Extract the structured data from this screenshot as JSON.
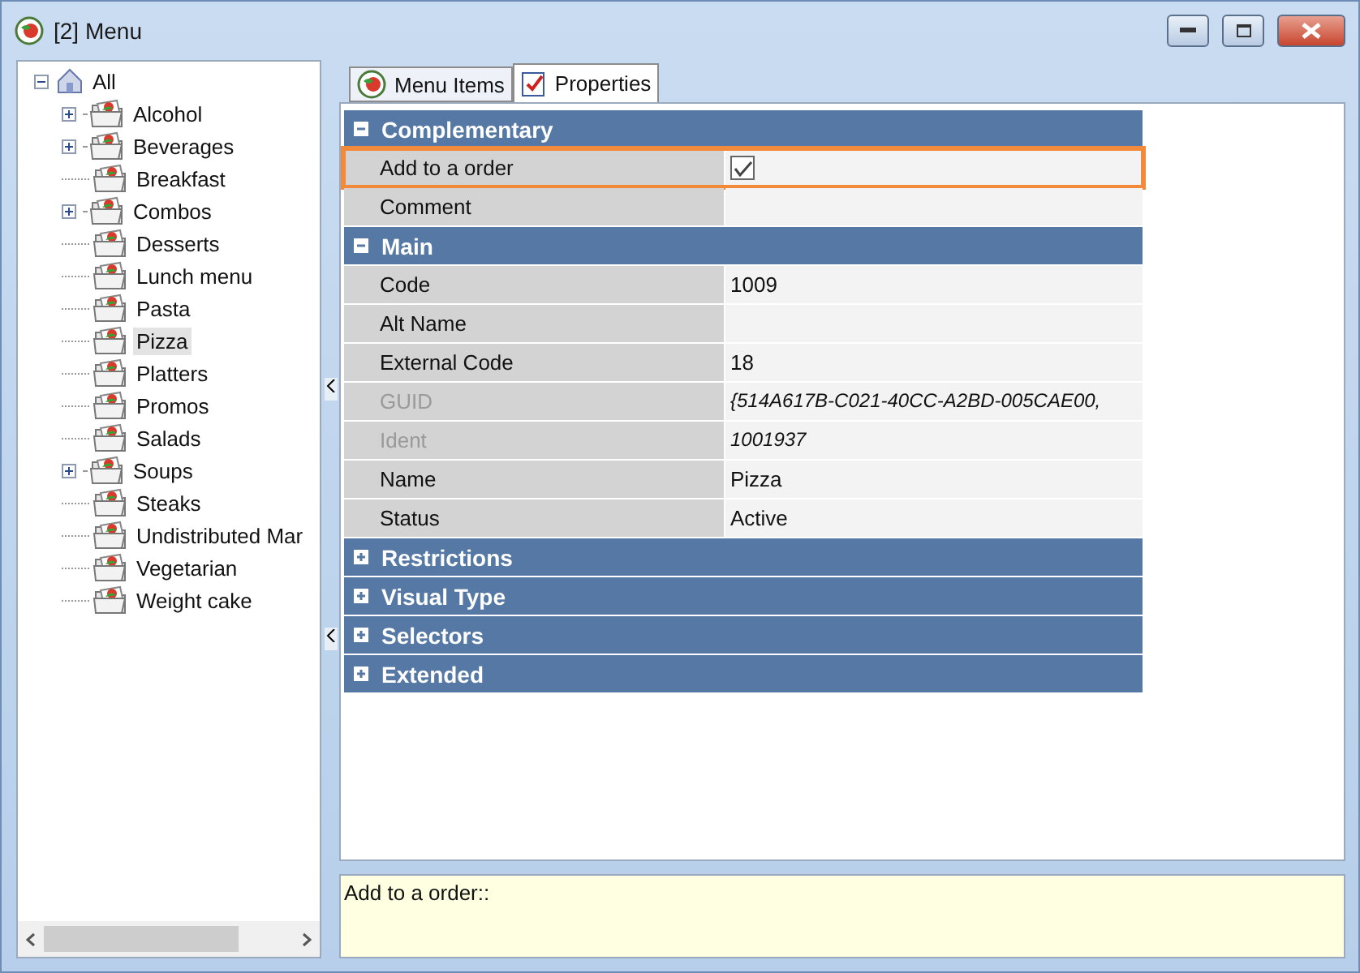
{
  "window": {
    "title": "[2] Menu"
  },
  "tree": {
    "label": "All",
    "expanded": true,
    "children": [
      {
        "label": "Alcohol",
        "kind": "folder",
        "selected": false
      },
      {
        "label": "Beverages",
        "kind": "folder",
        "selected": false
      },
      {
        "label": "Breakfast",
        "kind": "leaf",
        "selected": false
      },
      {
        "label": "Combos",
        "kind": "folder",
        "selected": false
      },
      {
        "label": "Desserts",
        "kind": "leaf",
        "selected": false
      },
      {
        "label": "Lunch menu",
        "kind": "leaf",
        "selected": false
      },
      {
        "label": "Pasta",
        "kind": "leaf",
        "selected": false
      },
      {
        "label": "Pizza",
        "kind": "leaf",
        "selected": true
      },
      {
        "label": "Platters",
        "kind": "leaf",
        "selected": false
      },
      {
        "label": "Promos",
        "kind": "leaf",
        "selected": false
      },
      {
        "label": "Salads",
        "kind": "leaf",
        "selected": false
      },
      {
        "label": "Soups",
        "kind": "folder",
        "selected": false
      },
      {
        "label": "Steaks",
        "kind": "leaf",
        "selected": false
      },
      {
        "label": "Undistributed Mar",
        "kind": "leaf",
        "selected": false
      },
      {
        "label": "Vegetarian",
        "kind": "leaf",
        "selected": false
      },
      {
        "label": "Weight cake",
        "kind": "leaf",
        "selected": false
      }
    ]
  },
  "tabs": [
    {
      "label": "Menu Items",
      "kind": "menu",
      "selected": false
    },
    {
      "label": "Properties",
      "kind": "properties",
      "selected": true
    }
  ],
  "categories": [
    {
      "label": "Complementary",
      "expanded": true,
      "rows": [
        {
          "label": "Add to a order",
          "kind": "checkbox",
          "checked": true,
          "focused": true,
          "disabled": false
        },
        {
          "label": "Comment",
          "kind": "text",
          "focused": false,
          "disabled": false
        }
      ]
    },
    {
      "label": "Main",
      "expanded": true,
      "rows": [
        {
          "label": "Code",
          "kind": "text",
          "value": "1009",
          "focused": false,
          "disabled": false
        },
        {
          "label": "Alt Name",
          "kind": "text",
          "focused": false,
          "disabled": false
        },
        {
          "label": "External Code",
          "kind": "text",
          "value": "18",
          "focused": false,
          "disabled": false
        },
        {
          "label": "GUID",
          "kind": "text",
          "value": "{514A617B-C021-40CC-A2BD-005CAE00,",
          "focused": false,
          "disabled": true
        },
        {
          "label": "Ident",
          "kind": "text",
          "value": "1001937",
          "focused": false,
          "disabled": true
        },
        {
          "label": "Name",
          "kind": "text",
          "value": "Pizza",
          "focused": false,
          "disabled": false
        },
        {
          "label": "Status",
          "kind": "text",
          "value": "Active",
          "focused": false,
          "disabled": false
        }
      ]
    },
    {
      "label": "Restrictions",
      "expanded": false
    },
    {
      "label": "Visual Type",
      "expanded": false
    },
    {
      "label": "Selectors",
      "expanded": false
    },
    {
      "label": "Extended",
      "expanded": false
    }
  ],
  "description": "Add to a order::"
}
